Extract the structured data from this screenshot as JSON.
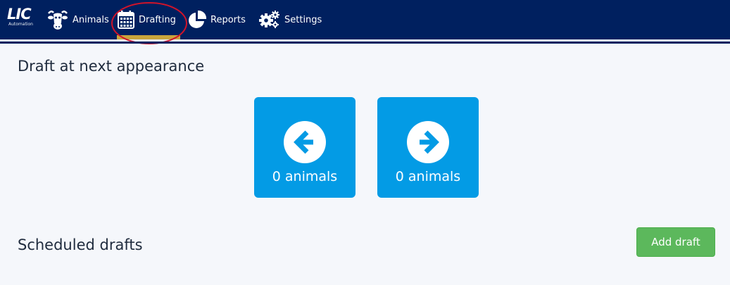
{
  "brand": {
    "name": "LIC",
    "tagline": "Automation"
  },
  "nav": {
    "items": [
      {
        "label": "Animals",
        "icon": "cow-head-icon"
      },
      {
        "label": "Drafting",
        "icon": "calendar-icon",
        "active": true
      },
      {
        "label": "Reports",
        "icon": "pie-chart-icon"
      },
      {
        "label": "Settings",
        "icon": "gears-icon"
      }
    ]
  },
  "draft_next": {
    "title": "Draft at next appearance",
    "left": {
      "icon": "arrow-left-circle-icon",
      "count_label": "0 animals"
    },
    "right": {
      "icon": "arrow-right-circle-icon",
      "count_label": "0 animals"
    }
  },
  "scheduled": {
    "title": "Scheduled drafts",
    "add_button": "Add draft"
  },
  "colors": {
    "navbar": "#00205f",
    "tile": "#039be5",
    "add_button": "#5cb85c",
    "active_underline": "#c8a53c",
    "annotation": "#d0142a"
  }
}
